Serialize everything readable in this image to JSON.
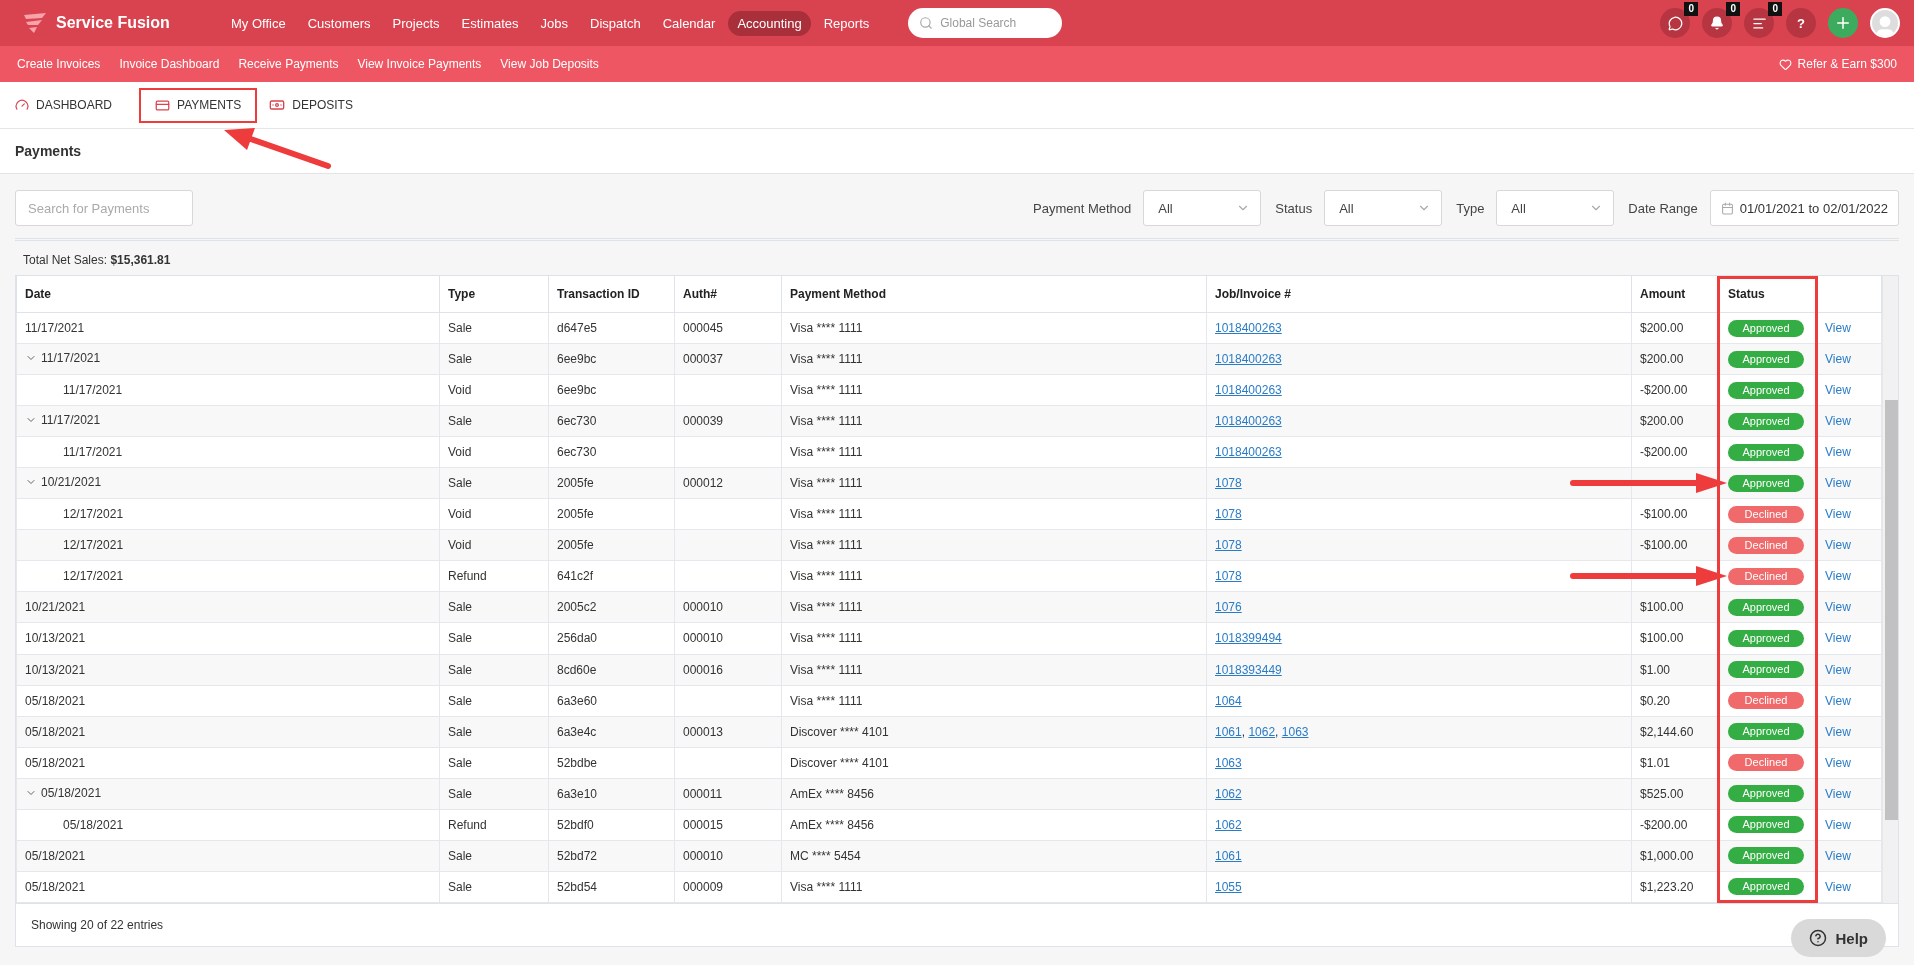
{
  "app": {
    "name": "Service Fusion"
  },
  "nav": [
    {
      "label": "My Office",
      "selected": false
    },
    {
      "label": "Customers",
      "selected": false
    },
    {
      "label": "Projects",
      "selected": false
    },
    {
      "label": "Estimates",
      "selected": false
    },
    {
      "label": "Jobs",
      "selected": false
    },
    {
      "label": "Dispatch",
      "selected": false
    },
    {
      "label": "Calendar",
      "selected": false
    },
    {
      "label": "Accounting",
      "selected": true
    },
    {
      "label": "Reports",
      "selected": false
    }
  ],
  "global_search": {
    "placeholder": "Global Search"
  },
  "header_icons": [
    {
      "kind": "chat",
      "badge": "0"
    },
    {
      "kind": "bell",
      "badge": "0"
    },
    {
      "kind": "list",
      "badge": "0"
    },
    {
      "kind": "help",
      "label": "?"
    },
    {
      "kind": "add"
    },
    {
      "kind": "avatar"
    }
  ],
  "subnav": [
    "Create Invoices",
    "Invoice Dashboard",
    "Receive Payments",
    "View Invoice Payments",
    "View Job Deposits"
  ],
  "refer": "Refer & Earn $300",
  "tabs": [
    {
      "label": "DASHBOARD",
      "kind": "gauge",
      "highlighted": false,
      "arrow": false
    },
    {
      "label": "PAYMENTS",
      "kind": "card",
      "highlighted": true,
      "arrow": true
    },
    {
      "label": "DEPOSITS",
      "kind": "cash",
      "highlighted": false,
      "arrow": false
    }
  ],
  "page_title": "Payments",
  "search": {
    "placeholder": "Search for Payments"
  },
  "filters": [
    {
      "kind": "select",
      "label": "Payment Method",
      "value": "All"
    },
    {
      "kind": "select",
      "label": "Status",
      "value": "All"
    },
    {
      "kind": "select",
      "label": "Type",
      "value": "All"
    },
    {
      "kind": "date_range",
      "label": "Date Range",
      "from": "01/01/2021",
      "separator": "to",
      "to": "02/01/2022"
    }
  ],
  "summary": {
    "label": "Total Net Sales:",
    "value": "$15,361.81"
  },
  "invoice_separator": ",",
  "table": {
    "columns": [
      {
        "label": "Date",
        "highlighted": false
      },
      {
        "label": "Type",
        "highlighted": false
      },
      {
        "label": "Transaction ID",
        "highlighted": false
      },
      {
        "label": "Auth#",
        "highlighted": false
      },
      {
        "label": "Payment Method",
        "highlighted": false
      },
      {
        "label": "Job/Invoice #",
        "highlighted": false
      },
      {
        "label": "Amount",
        "highlighted": false
      },
      {
        "label": "Status",
        "highlighted": true
      }
    ],
    "rows": [
      {
        "date": "11/17/2021",
        "type": "Sale",
        "transaction_id": "d647e5",
        "auth": "000045",
        "payment_method": "Visa **** 1111",
        "invoices": [
          "1018400263"
        ],
        "amount": "$200.00",
        "status": {
          "label": "Approved",
          "kind": "approved"
        },
        "action": "View",
        "arrow": false
      },
      {
        "date": "11/17/2021",
        "type": "Sale",
        "transaction_id": "6ee9bc",
        "auth": "000037",
        "payment_method": "Visa **** 1111",
        "invoices": [
          "1018400263"
        ],
        "amount": "$200.00",
        "status": {
          "label": "Approved",
          "kind": "approved"
        },
        "action": "View",
        "arrow": false,
        "expanded": true,
        "children": [
          {
            "date": "11/17/2021",
            "type": "Void",
            "transaction_id": "6ee9bc",
            "payment_method": "Visa **** 1111",
            "invoices": [
              "1018400263"
            ],
            "amount": "-$200.00",
            "status": {
              "label": "Approved",
              "kind": "approved"
            },
            "action": "View",
            "arrow": false
          }
        ]
      },
      {
        "date": "11/17/2021",
        "type": "Sale",
        "transaction_id": "6ec730",
        "auth": "000039",
        "payment_method": "Visa **** 1111",
        "invoices": [
          "1018400263"
        ],
        "amount": "$200.00",
        "status": {
          "label": "Approved",
          "kind": "approved"
        },
        "action": "View",
        "arrow": false,
        "expanded": true,
        "children": [
          {
            "date": "11/17/2021",
            "type": "Void",
            "transaction_id": "6ec730",
            "payment_method": "Visa **** 1111",
            "invoices": [
              "1018400263"
            ],
            "amount": "-$200.00",
            "status": {
              "label": "Approved",
              "kind": "approved"
            },
            "action": "View",
            "arrow": false
          }
        ]
      },
      {
        "date": "10/21/2021",
        "type": "Sale",
        "transaction_id": "2005fe",
        "auth": "000012",
        "payment_method": "Visa **** 1111",
        "invoices": [
          "1078"
        ],
        "status": {
          "label": "Approved",
          "kind": "approved"
        },
        "action": "View",
        "arrow": true,
        "expanded": true,
        "children": [
          {
            "date": "12/17/2021",
            "type": "Void",
            "transaction_id": "2005fe",
            "payment_method": "Visa **** 1111",
            "invoices": [
              "1078"
            ],
            "amount": "-$100.00",
            "status": {
              "label": "Declined",
              "kind": "declined"
            },
            "action": "View",
            "arrow": false
          },
          {
            "date": "12/17/2021",
            "type": "Void",
            "transaction_id": "2005fe",
            "payment_method": "Visa **** 1111",
            "invoices": [
              "1078"
            ],
            "amount": "-$100.00",
            "status": {
              "label": "Declined",
              "kind": "declined"
            },
            "action": "View",
            "arrow": false
          },
          {
            "date": "12/17/2021",
            "type": "Refund",
            "transaction_id": "641c2f",
            "payment_method": "Visa **** 1111",
            "invoices": [
              "1078"
            ],
            "status": {
              "label": "Declined",
              "kind": "declined"
            },
            "action": "View",
            "arrow": true
          }
        ]
      },
      {
        "date": "10/21/2021",
        "type": "Sale",
        "transaction_id": "2005c2",
        "auth": "000010",
        "payment_method": "Visa **** 1111",
        "invoices": [
          "1076"
        ],
        "amount": "$100.00",
        "status": {
          "label": "Approved",
          "kind": "approved"
        },
        "action": "View",
        "arrow": false
      },
      {
        "date": "10/13/2021",
        "type": "Sale",
        "transaction_id": "256da0",
        "auth": "000010",
        "payment_method": "Visa **** 1111",
        "invoices": [
          "1018399494"
        ],
        "amount": "$100.00",
        "status": {
          "label": "Approved",
          "kind": "approved"
        },
        "action": "View",
        "arrow": false
      },
      {
        "date": "10/13/2021",
        "type": "Sale",
        "transaction_id": "8cd60e",
        "auth": "000016",
        "payment_method": "Visa **** 1111",
        "invoices": [
          "1018393449"
        ],
        "amount": "$1.00",
        "status": {
          "label": "Approved",
          "kind": "approved"
        },
        "action": "View",
        "arrow": false
      },
      {
        "date": "05/18/2021",
        "type": "Sale",
        "transaction_id": "6a3e60",
        "payment_method": "Visa **** 1111",
        "invoices": [
          "1064"
        ],
        "amount": "$0.20",
        "status": {
          "label": "Declined",
          "kind": "declined"
        },
        "action": "View",
        "arrow": false
      },
      {
        "date": "05/18/2021",
        "type": "Sale",
        "transaction_id": "6a3e4c",
        "auth": "000013",
        "payment_method": "Discover **** 4101",
        "invoices": [
          "1061",
          "1062",
          "1063"
        ],
        "amount": "$2,144.60",
        "status": {
          "label": "Approved",
          "kind": "approved"
        },
        "action": "View",
        "arrow": false
      },
      {
        "date": "05/18/2021",
        "type": "Sale",
        "transaction_id": "52bdbe",
        "payment_method": "Discover **** 4101",
        "invoices": [
          "1063"
        ],
        "amount": "$1.01",
        "status": {
          "label": "Declined",
          "kind": "declined"
        },
        "action": "View",
        "arrow": false
      },
      {
        "date": "05/18/2021",
        "type": "Sale",
        "transaction_id": "6a3e10",
        "auth": "000011",
        "payment_method": "AmEx **** 8456",
        "invoices": [
          "1062"
        ],
        "amount": "$525.00",
        "status": {
          "label": "Approved",
          "kind": "approved"
        },
        "action": "View",
        "arrow": false,
        "expanded": true,
        "children": [
          {
            "date": "05/18/2021",
            "type": "Refund",
            "transaction_id": "52bdf0",
            "auth": "000015",
            "payment_method": "AmEx **** 8456",
            "invoices": [
              "1062"
            ],
            "amount": "-$200.00",
            "status": {
              "label": "Approved",
              "kind": "approved"
            },
            "action": "View",
            "arrow": false
          }
        ]
      },
      {
        "date": "05/18/2021",
        "type": "Sale",
        "transaction_id": "52bd72",
        "auth": "000010",
        "payment_method": "MC **** 5454",
        "invoices": [
          "1061"
        ],
        "amount": "$1,000.00",
        "status": {
          "label": "Approved",
          "kind": "approved"
        },
        "action": "View",
        "arrow": false
      },
      {
        "date": "05/18/2021",
        "type": "Sale",
        "transaction_id": "52bd54",
        "auth": "000009",
        "payment_method": "Visa **** 1111",
        "invoices": [
          "1055"
        ],
        "amount": "$1,223.20",
        "status": {
          "label": "Approved",
          "kind": "approved"
        },
        "action": "View",
        "arrow": false
      }
    ]
  },
  "footer": "Showing 20 of 22 entries",
  "help": "Help"
}
